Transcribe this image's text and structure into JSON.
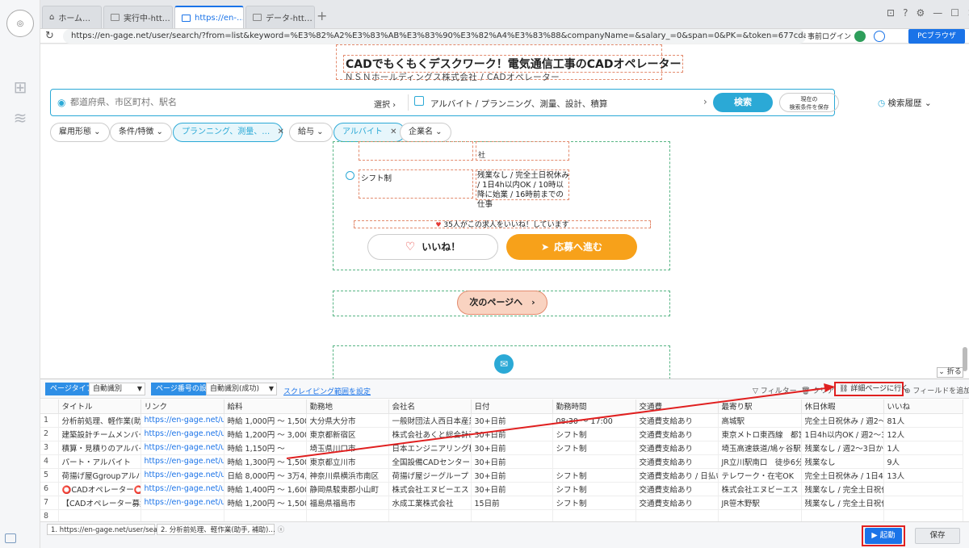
{
  "tabs": [
    {
      "label": "ホーム…",
      "active": false
    },
    {
      "label": "実行中-htt…",
      "active": false
    },
    {
      "label": "https://en-…",
      "active": true
    },
    {
      "label": "データ-htt…",
      "active": false
    }
  ],
  "address": {
    "url": "https://en-gage.net/user/search/?from=list&keyword=%E3%82%A2%E3%83%AB%E3%83%90%E3%82%A4%E3%83%88&companyName=&salary_=0&span=0&PK=&token=677cda4cc113a&area=…",
    "prelogin": "事前ログイン",
    "mode": "PCブラウザ"
  },
  "job": {
    "title": "CADでもくもくデスクワーク！電気通信工事のCADオペレーター",
    "company": "ＮＳＮホールディングス株式会社 / CADオペレーター",
    "shift_label": "シフト制",
    "shift_text": "残業なし / 完全土日祝休み / 1日4h以内OK / 10時以降に始業 / 16時前までの仕事",
    "fragment": "社",
    "likes_text": "35人がこの求人をいいね！しています",
    "like_button": "いいね！",
    "apply_button": "応募へ進む",
    "next_page": "次のページへ"
  },
  "search": {
    "location_placeholder": "都道府県、市区町村、駅名",
    "select_label": "選択",
    "condition": "アルバイト / プランニング、測量、設計、積算",
    "search_button": "検索",
    "save_button_line1": "現在の",
    "save_button_line2": "検索条件を保存",
    "history": "検索履歴"
  },
  "filters": [
    {
      "label": "雇用形態",
      "on": false
    },
    {
      "label": "条件/特徴",
      "on": false
    },
    {
      "label": "プランニング、測量、…",
      "on": true
    },
    {
      "label": "給与",
      "on": false
    },
    {
      "label": "アルバイト",
      "on": true
    },
    {
      "label": "企業名",
      "on": false
    }
  ],
  "panel": {
    "fold": "折る",
    "page_type_label": "ページタイプ",
    "page_type_value": "自動識別",
    "page_num_label": "ページ番号の設定",
    "page_num_value": "自動識別(成功)",
    "scrape_range_link": "スクレイピング範囲を設定",
    "filter": "フィルター",
    "clear": "クリア",
    "detail": "詳細ページに行く",
    "add_field": "フィールドを追加"
  },
  "table": {
    "headers": [
      "",
      "タイトル",
      "リンク",
      "給料",
      "勤務地",
      "会社名",
      "日付",
      "勤務時間",
      "交通費",
      "最寄り駅",
      "休日休暇",
      "いいね"
    ],
    "rows": [
      [
        "1",
        "分析前処理、軽作業(助手、…",
        "https://en-gage.net/user/s…",
        "時給 1,000円 ～ 1,500円",
        "大分県大分市",
        "一般財団法人西日本産業…",
        "30+日前",
        "08:30 ～ 17:00",
        "交通費支給あり",
        "高城駅",
        "完全土日祝休み / 週2～3…",
        "81人"
      ],
      [
        "2",
        "建築設計チームメンバー(…",
        "https://en-gage.net/user/s…",
        "時給 1,200円 ～ 3,000円",
        "東京都新宿区",
        "株式会社あくと総合計画",
        "30+日前",
        "シフト制",
        "交通費支給あり",
        "東京メトロ東西線　都営…",
        "1日4h以内OK / 週2～3日…",
        "12人"
      ],
      [
        "3",
        "積算・見積りのアルバイ…",
        "https://en-gage.net/user/s…",
        "時給 1,150円 ～",
        "埼玉県川口市",
        "日本エンジニアリング株…",
        "30+日前",
        "シフト制",
        "交通費支給あり",
        "埼玉高速鉄道/鳩ヶ谷駅",
        "残業なし / 週2～3日からOK",
        "1人"
      ],
      [
        "4",
        "パート・アルバイト",
        "https://en-gage.net/user/s…",
        "時給 1,300円 ～ 1,500円",
        "東京都立川市",
        "全国設備CADセンター",
        "30+日前",
        "",
        "交通費支給あり",
        "JR立川駅南口　徒歩6分…",
        "残業なし",
        "9人"
      ],
      [
        "5",
        "荷揚げ屋Ggroupアルバイト",
        "https://en-gage.net/user/s…",
        "日給 8,000円 ～ 3万4,000円",
        "神奈川県横浜市南区",
        "荷揚げ屋ジーグループ",
        "30+日前",
        "シフト制",
        "交通費支給あり / 日払い…",
        "テレワーク・在宅OK",
        "完全土日祝休み / 1日4h以…",
        "13人"
      ],
      [
        "6",
        "⭕CADオペレーター⭕…",
        "https://en-gage.net/user/s…",
        "時給 1,400円 ～ 1,600円",
        "静岡県駿東郡小山町",
        "株式会社エヌビーエス",
        "30+日前",
        "シフト制",
        "交通費支給あり",
        "株式会社エヌビーエス",
        "残業なし / 完全土日祝休…",
        ""
      ],
      [
        "7",
        "【CADオペレーター募集…",
        "https://en-gage.net/user/s…",
        "時給 1,200円 ～ 1,500円",
        "福島県福島市",
        "水成工業株式会社",
        "15日前",
        "シフト制",
        "交通費支給あり",
        "JR笹木野駅",
        "残業なし / 完全土日祝休…",
        ""
      ],
      [
        "8",
        "",
        "",
        "",
        "",
        "",
        "",
        "",
        "",
        "",
        "",
        ""
      ]
    ]
  },
  "bottom": {
    "tab1": "1. https://en-gage.net/user/search/…",
    "tab2": "2. 分析前処理、軽作業(助手, 補助)…",
    "start": "起動",
    "save": "保存"
  },
  "colors": {
    "accent": "#1a73e8",
    "brand": "#2ba9d6",
    "orange": "#f7a11a",
    "highlight": "#e02020"
  }
}
